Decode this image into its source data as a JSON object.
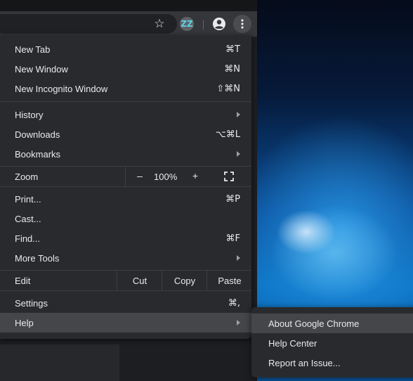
{
  "toolbar": {
    "star_glyph": "☆",
    "extension_glyph": "ZZ"
  },
  "menu": {
    "group1": [
      {
        "label": "New Tab",
        "shortcut": "⌘T"
      },
      {
        "label": "New Window",
        "shortcut": "⌘N"
      },
      {
        "label": "New Incognito Window",
        "shortcut": "⇧⌘N"
      }
    ],
    "group2": [
      {
        "label": "History",
        "shortcut": ""
      },
      {
        "label": "Downloads",
        "shortcut": "⌥⌘L"
      },
      {
        "label": "Bookmarks",
        "shortcut": ""
      }
    ],
    "zoom": {
      "label": "Zoom",
      "minus": "–",
      "value": "100%",
      "plus": "+"
    },
    "group3": [
      {
        "label": "Print...",
        "shortcut": "⌘P"
      },
      {
        "label": "Cast...",
        "shortcut": ""
      },
      {
        "label": "Find...",
        "shortcut": "⌘F"
      },
      {
        "label": "More Tools",
        "shortcut": ""
      }
    ],
    "edit": {
      "label": "Edit",
      "cut": "Cut",
      "copy": "Copy",
      "paste": "Paste"
    },
    "group4": [
      {
        "label": "Settings",
        "shortcut": "⌘,"
      },
      {
        "label": "Help",
        "shortcut": ""
      }
    ]
  },
  "help_submenu": [
    {
      "label": "About Google Chrome"
    },
    {
      "label": "Help Center"
    },
    {
      "label": "Report an Issue..."
    }
  ],
  "colors": {
    "menu_bg": "#292a2d",
    "highlight": "#45464a",
    "text": "#e8eaed",
    "extension_accent": "#5fd3e6"
  }
}
